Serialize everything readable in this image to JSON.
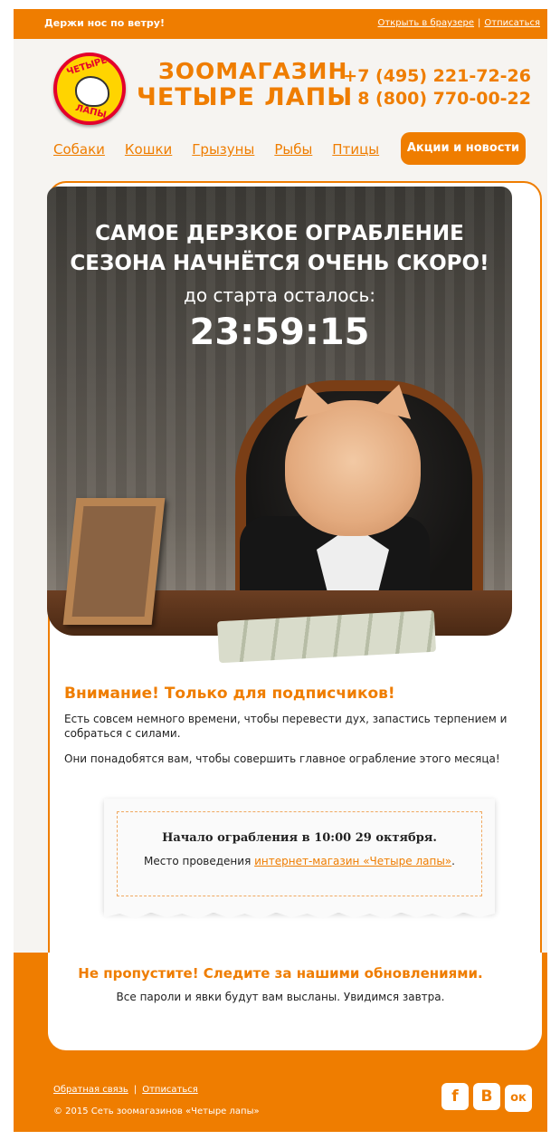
{
  "topbar": {
    "tagline": "Держи нос по ветру!",
    "open_in_browser": "Открыть в браузере",
    "separator": "|",
    "unsubscribe": "Отписаться"
  },
  "brand": {
    "name_line1": "ЗООМАГАЗИН",
    "name_line2": "ЧЕТЫРЕ ЛАПЫ",
    "logo_text_top": "ЧЕТЫРЕ",
    "logo_text_bottom": "ЛАПЫ"
  },
  "phones": [
    "+7 (495) 221-72-26",
    "8 (800) 770-00-22"
  ],
  "nav": {
    "items": [
      "Собаки",
      "Кошки",
      "Грызуны",
      "Рыбы",
      "Птицы"
    ],
    "promo": "Акции и новости"
  },
  "hero": {
    "headline_line1": "САМОЕ ДЕРЗКОЕ ОГРАБЛЕНИЕ",
    "headline_line2": "СЕЗОНА НАЧНЁТСЯ ОЧЕНЬ СКОРО!",
    "countdown_label": "до старта осталось:",
    "countdown": "23:59:15"
  },
  "attention": {
    "title": "Внимание! Только для подписчиков!",
    "paragraph1": "Есть совсем немного времени, чтобы перевести дух, запастись терпением и собраться с силами.",
    "paragraph2": "Они понадобятся вам, чтобы совершить главное ограбление этого месяца!"
  },
  "note": {
    "start": "Начало ограбления в 10:00 29 октября.",
    "place_prefix": "Место проведения ",
    "place_link": "интернет-магазин «Четыре лапы»",
    "place_suffix": "."
  },
  "follow": {
    "title": "Не пропустите! Следите за нашими обновлениями.",
    "text": "Все пароли и явки будут вам высланы. Увидимся завтра."
  },
  "footer": {
    "feedback": "Обратная связь",
    "separator": "|",
    "unsubscribe": "Отписаться",
    "copyright": "© 2015 Сеть зоомагазинов «Четыре лапы»",
    "socials": [
      {
        "icon": "facebook-icon",
        "glyph": "f"
      },
      {
        "icon": "vkontakte-icon",
        "glyph": "B"
      },
      {
        "icon": "odnoklassniki-icon",
        "glyph": "ок"
      }
    ]
  },
  "colors": {
    "accent": "#ef7d00",
    "text": "#222222",
    "logo_red": "#e4002b",
    "logo_yellow": "#ffd400"
  }
}
